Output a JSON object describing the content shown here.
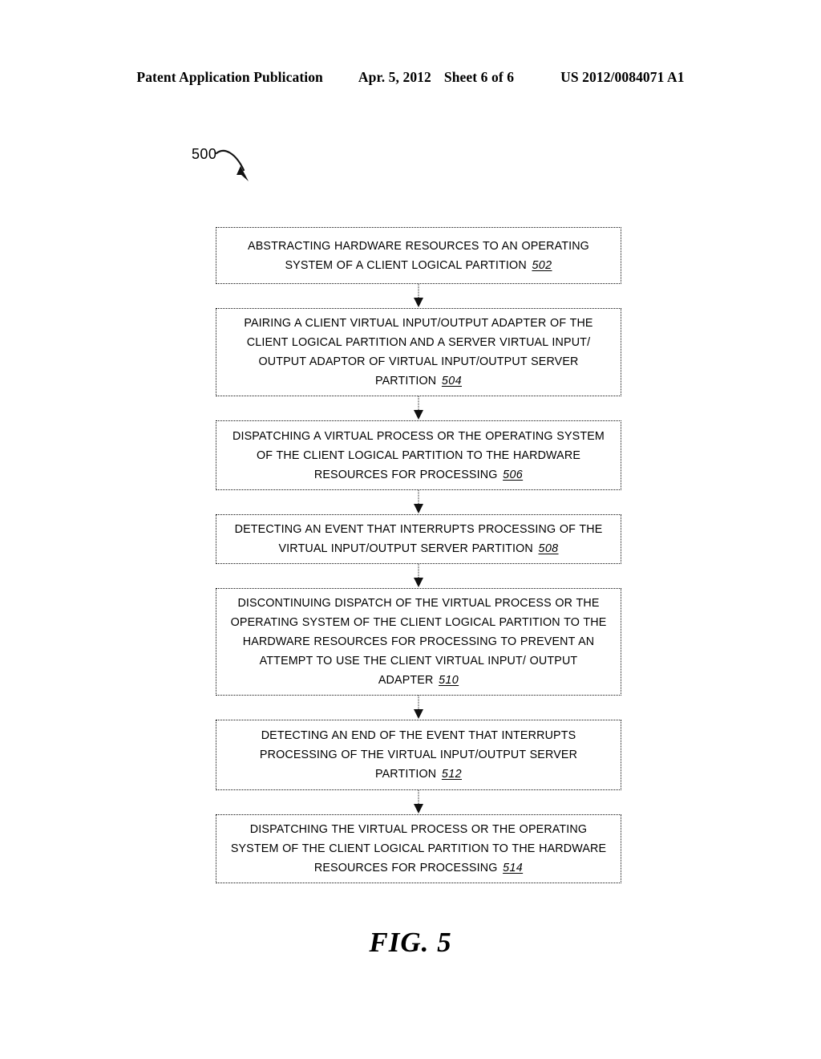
{
  "header": {
    "publication": "Patent Application Publication",
    "date": "Apr. 5, 2012",
    "sheet": "Sheet 6 of 6",
    "patent_number": "US 2012/0084071 A1"
  },
  "figure": {
    "reference_label": "500",
    "caption": "FIG. 5"
  },
  "flowchart": {
    "steps": [
      {
        "text": "ABSTRACTING HARDWARE RESOURCES TO AN OPERATING SYSTEM OF A CLIENT LOGICAL PARTITION",
        "ref": "502"
      },
      {
        "text": "PAIRING A CLIENT VIRTUAL INPUT/OUTPUT ADAPTER OF THE CLIENT LOGICAL PARTITION AND A SERVER VIRTUAL INPUT/ OUTPUT ADAPTOR OF VIRTUAL INPUT/OUTPUT SERVER PARTITION",
        "ref": "504"
      },
      {
        "text": "DISPATCHING A VIRTUAL PROCESS OR THE OPERATING SYSTEM OF THE CLIENT LOGICAL PARTITION TO THE HARDWARE RESOURCES FOR PROCESSING",
        "ref": "506"
      },
      {
        "text": "DETECTING AN EVENT THAT INTERRUPTS PROCESSING OF THE VIRTUAL INPUT/OUTPUT SERVER PARTITION",
        "ref": "508"
      },
      {
        "text": "DISCONTINUING DISPATCH OF THE VIRTUAL PROCESS OR THE OPERATING SYSTEM OF THE CLIENT LOGICAL PARTITION TO THE HARDWARE RESOURCES FOR PROCESSING TO PREVENT AN ATTEMPT TO USE THE CLIENT VIRTUAL INPUT/ OUTPUT ADAPTER",
        "ref": "510"
      },
      {
        "text": "DETECTING AN END OF THE EVENT THAT INTERRUPTS PROCESSING OF THE VIRTUAL INPUT/OUTPUT SERVER PARTITION",
        "ref": "512"
      },
      {
        "text": "DISPATCHING THE VIRTUAL PROCESS OR THE OPERATING SYSTEM OF THE CLIENT LOGICAL PARTITION TO THE HARDWARE RESOURCES FOR PROCESSING",
        "ref": "514"
      }
    ]
  },
  "colors": {
    "ink": "#000000",
    "page": "#ffffff"
  }
}
